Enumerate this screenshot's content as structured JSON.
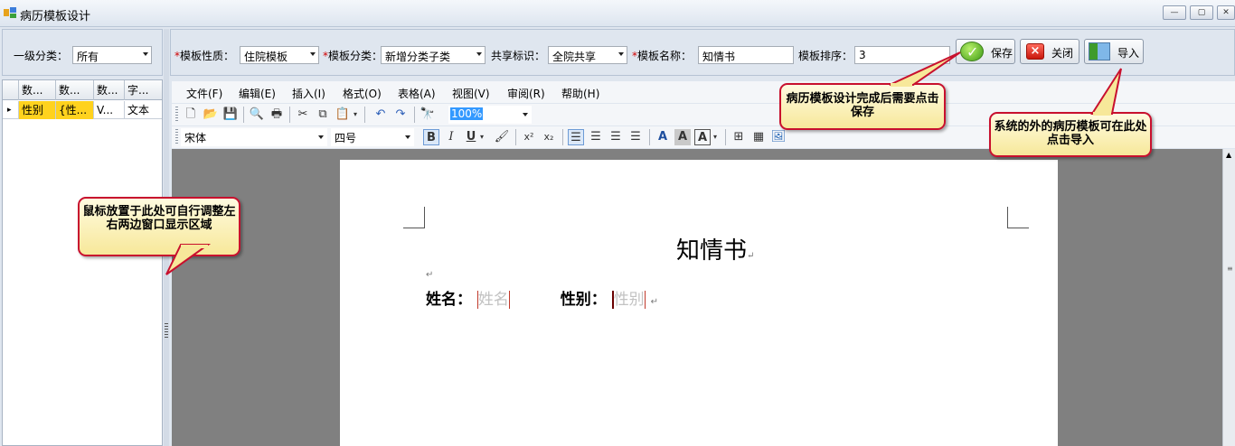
{
  "window": {
    "title": "病历模板设计",
    "min": "—",
    "max": "▢",
    "close": "✕"
  },
  "filter": {
    "level1_label": "一级分类：",
    "level1_value": "所有"
  },
  "form": {
    "nature_label": "模板性质：",
    "nature_value": "住院模板",
    "category_label": "模板分类：",
    "category_value": "新增分类子类",
    "share_label": "共享标识：",
    "share_value": "全院共享",
    "name_label": "模板名称：",
    "name_value": "知情书",
    "order_label": "模板排序：",
    "order_value": "3",
    "required_mark": "*"
  },
  "buttons": {
    "save": "保存",
    "close": "关闭",
    "import": "导入"
  },
  "grid": {
    "headers": [
      "数...",
      "数...",
      "数...",
      "字..."
    ],
    "rows": [
      {
        "marker": "▸",
        "cells": [
          "性别",
          "{性...",
          "V...",
          "文本"
        ]
      }
    ]
  },
  "menu": [
    "文件(F)",
    "编辑(E)",
    "插入(I)",
    "格式(O)",
    "表格(A)",
    "视图(V)",
    "审阅(R)",
    "帮助(H)"
  ],
  "toolbar": {
    "zoom": "100%",
    "font": "宋体",
    "size": "四号",
    "bold": "B",
    "italic": "I",
    "underline": "U"
  },
  "document": {
    "title": "知情书",
    "name_label": "姓名：",
    "name_field": "姓名",
    "gender_label": "性别：",
    "gender_field": "性别",
    "para_mark": "↵"
  },
  "callouts": {
    "splitter_tip": "鼠标放置于此处可自行调整左右两边窗口显示区域",
    "save_tip": "病历模板设计完成后需要点击保存",
    "import_tip": "系统的外的病历模板可在此处点击导入"
  },
  "colors": {
    "highlight": "#ffd21e",
    "callout_border": "#c8102e",
    "callout_fill": "#f7e89a",
    "required": "#d00000"
  }
}
